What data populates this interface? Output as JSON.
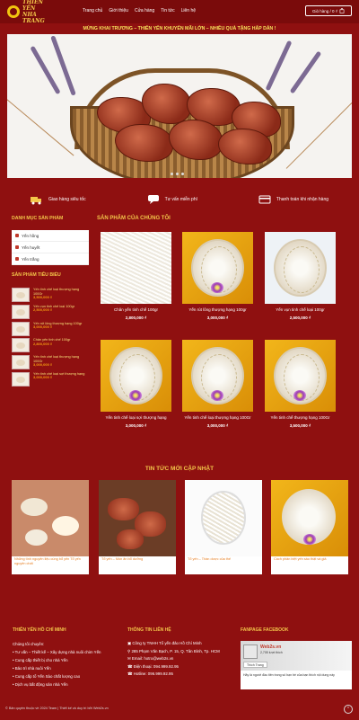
{
  "header": {
    "logo_line1": "THIÊN YẾN",
    "logo_line2": "NHA TRANG",
    "nav": [
      "Trang chủ",
      "Giới thiệu",
      "Cửa hàng",
      "Tin tức",
      "Liên hệ"
    ],
    "cart_label": "Giỏ hàng / 0 ₫"
  },
  "announcement": "MỪNG KHAI TRƯƠNG – THIÊN YẾN KHUYẾN MÃI LỚN – NHIỀU QUÀ TẶNG HẤP DẪN !",
  "features": [
    {
      "icon": "truck-icon",
      "label": "Giao hàng siêu tốc"
    },
    {
      "icon": "chat-icon",
      "label": "Tư vấn miễn phí"
    },
    {
      "icon": "payment-icon",
      "label": "Thanh toán khi nhận hàng"
    }
  ],
  "sidebar": {
    "categories_title": "DANH MỤC SẢN PHẨM",
    "categories": [
      "Yến hồng",
      "Yến huyết",
      "Yến trắng"
    ],
    "bestseller_title": "SẢN PHẨM TIÊU BIỂU",
    "bestsellers": [
      {
        "name": "Yến tinh chế loại thượng hạng 100Gr",
        "price": "3,500,000 ₫"
      },
      {
        "name": "Yến vụn tinh chế loại 100gr",
        "price": "2,500,000 ₫"
      },
      {
        "name": "Yến rút lông thượng hạng 100gr",
        "price": "3,000,000 ₫"
      },
      {
        "name": "Chân yến tinh chế 100gr",
        "price": "2,800,000 ₫"
      },
      {
        "name": "Yến tinh chế loại thượng hạng 100Gr",
        "price": "3,000,000 ₫"
      },
      {
        "name": "Yến tinh chế loại sợi thượng hạng",
        "price": "3,000,000 ₫"
      }
    ]
  },
  "products": {
    "title": "SẢN PHẨM CỦA CHÚNG TÔI",
    "items": [
      {
        "name": "Chân yến tinh chế 100gr",
        "price": "2,800,000 ₫"
      },
      {
        "name": "Yến rút lông thượng hạng 100gr",
        "price": "3,000,000 ₫"
      },
      {
        "name": "Yến vụn tinh chế loại 100gr",
        "price": "2,500,000 ₫"
      },
      {
        "name": "Yến tinh chế loại sợi thượng hạng",
        "price": "3,000,000 ₫"
      },
      {
        "name": "Yến tinh chế loại thượng hạng 100Gr",
        "price": "3,000,000 ₫"
      },
      {
        "name": "Yến tinh chế thượng hạng 100Gr",
        "price": "3,500,000 ₫"
      }
    ]
  },
  "news": {
    "title": "TIN TỨC MỚI CẬP NHẬT",
    "items": [
      {
        "title": "Những tính nguyên liệu cùng bổ yến Tổ yến nguyên chất"
      },
      {
        "title": "Tổ yến – Món ăn bổ dưỡng"
      },
      {
        "title": "Tổ yến – Thần dược của thế"
      },
      {
        "title": "Cách phân biệt yến sào thật và giả"
      }
    ]
  },
  "footer": {
    "col1_title": "THIÊN YẾN HỒ CHÍ MINH",
    "col1_lines": [
      "Chúng tôi chuyên:",
      "• Tư vấn – Thiết kế – Xây dựng nhà nuôi chim Yến",
      "• Cung cấp thiết bị cho nhà Yến",
      "• Bảo trì nhà nuôi Yến",
      "• Cung cấp tổ Yến Sào chất lượng cao",
      "• Dịch vụ bất động sản nhà Yến"
    ],
    "col2_title": "THÔNG TIN LIÊN HỆ",
    "col2_lines": [
      "Công ty TNHH Tổ yến đảo Hồ Chí Minh",
      "285 Phạm Văn Bạch, P. 15, Q. Tân Bình, Tp. HCM",
      "Email: hotro@web2s.vn",
      "Điện thoại: 094.999.92.95",
      "Hotline: 096.999.92.95"
    ],
    "col3_title": "FANPAGE FACEBOOK",
    "fb_name": "Web2s.vn",
    "fb_likes": "2,705 lượt thích",
    "fb_button": "Thích Trang",
    "fb_caption": "Hãy là người đầu tiên trong số bạn bè của bạn thích nội dung này",
    "copyright": "© Bản quyền thuộc về 2024 Team | Thiết kế và duy trì bởi Web2s.vn"
  }
}
